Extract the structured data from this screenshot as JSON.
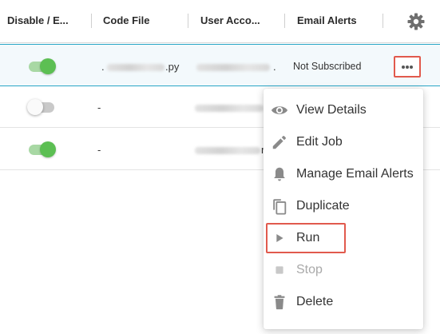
{
  "table": {
    "columns": [
      "Disable / E...",
      "Code File",
      "User Acco...",
      "Email Alerts"
    ],
    "rows": [
      {
        "enabled": true,
        "code_file": ".",
        "code_file_suffix": ".py",
        "user_account_suffix": ".",
        "email_alerts": "Not Subscribed"
      },
      {
        "enabled": false,
        "code_file": "-",
        "code_file_suffix": "",
        "user_account_suffix": "",
        "email_alerts": ""
      },
      {
        "enabled": true,
        "code_file": "-",
        "code_file_suffix": "",
        "user_account_suffix": "r",
        "email_alerts": ""
      }
    ]
  },
  "icons": {
    "settings": "gear-icon",
    "row_actions": "more-horizontal-icon"
  },
  "menu": {
    "items": [
      {
        "label": "View Details",
        "icon": "eye-icon",
        "disabled": false
      },
      {
        "label": "Edit Job",
        "icon": "pencil-icon",
        "disabled": false
      },
      {
        "label": "Manage Email Alerts",
        "icon": "bell-icon",
        "disabled": false
      },
      {
        "label": "Duplicate",
        "icon": "copy-icon",
        "disabled": false
      },
      {
        "label": "Run",
        "icon": "play-icon",
        "disabled": false,
        "highlighted": true
      },
      {
        "label": "Stop",
        "icon": "stop-icon",
        "disabled": true
      },
      {
        "label": "Delete",
        "icon": "trash-icon",
        "disabled": false
      }
    ]
  },
  "colors": {
    "highlight_outline": "#e15a4d",
    "selected_row_border": "#2aa6c6",
    "toggle_on": "#5cbf53",
    "icon_gray": "#8a8a8a"
  }
}
